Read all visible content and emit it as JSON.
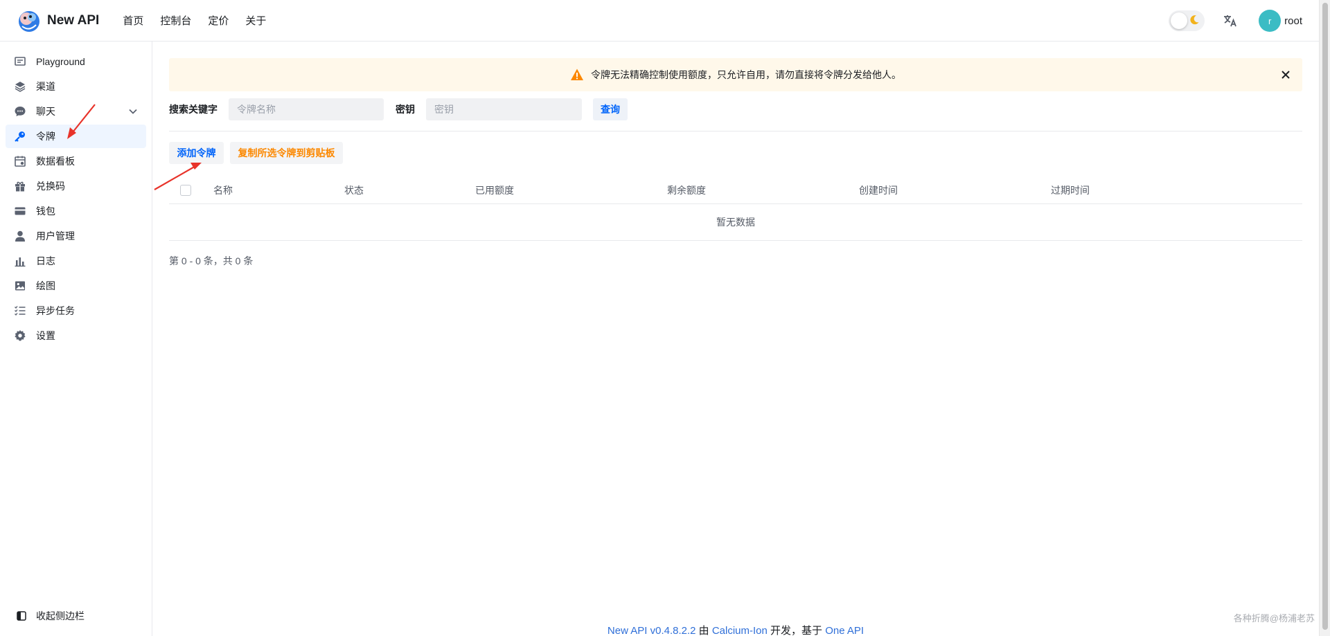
{
  "app": {
    "name": "New API"
  },
  "top_nav": [
    {
      "label": "首页"
    },
    {
      "label": "控制台"
    },
    {
      "label": "定价"
    },
    {
      "label": "关于"
    }
  ],
  "user": {
    "avatar_letter": "r",
    "name": "root"
  },
  "icons": {
    "theme_toggle": "moon-icon",
    "language": "translate-icon",
    "banner": "warning-icon",
    "close": "close-icon"
  },
  "sidebar": {
    "items": [
      {
        "label": "Playground",
        "icon": "chat-square-icon"
      },
      {
        "label": "渠道",
        "icon": "layers-icon"
      },
      {
        "label": "聊天",
        "icon": "chat-bubble-icon"
      },
      {
        "label": "令牌",
        "icon": "key-icon",
        "active": true
      },
      {
        "label": "数据看板",
        "icon": "calendar-chart-icon"
      },
      {
        "label": "兑换码",
        "icon": "gift-icon"
      },
      {
        "label": "钱包",
        "icon": "credit-card-icon"
      },
      {
        "label": "用户管理",
        "icon": "user-icon"
      },
      {
        "label": "日志",
        "icon": "bar-chart-icon"
      },
      {
        "label": "绘图",
        "icon": "image-icon"
      },
      {
        "label": "异步任务",
        "icon": "checklist-icon"
      },
      {
        "label": "设置",
        "icon": "gear-icon"
      }
    ],
    "collapse_label": "收起侧边栏"
  },
  "banner": {
    "text": "令牌无法精确控制使用额度，只允许自用，请勿直接将令牌分发给他人。"
  },
  "search": {
    "keyword_label": "搜索关键字",
    "name_placeholder": "令牌名称",
    "key_label": "密钥",
    "key_placeholder": "密钥",
    "query_button": "查询"
  },
  "actions": {
    "add_token": "添加令牌",
    "copy_selected": "复制所选令牌到剪贴板"
  },
  "table": {
    "columns": [
      "名称",
      "状态",
      "已用额度",
      "剩余额度",
      "创建时间",
      "过期时间"
    ],
    "empty_text": "暂无数据"
  },
  "pager": {
    "text": "第 0 - 0 条，共 0 条"
  },
  "footer": {
    "version_link": "New API v0.4.8.2.2",
    "by": " 由 ",
    "author_link": "Calcium-Ion",
    "dev": " 开发，基于 ",
    "base_link": "One API"
  },
  "watermark": "各种折腾@杨浦老苏",
  "colors": {
    "accent": "#0064fa",
    "orange": "#fc8800",
    "warning": "#fc8800",
    "arrow": "#e8332a",
    "avatar": "#3bbcc4"
  }
}
